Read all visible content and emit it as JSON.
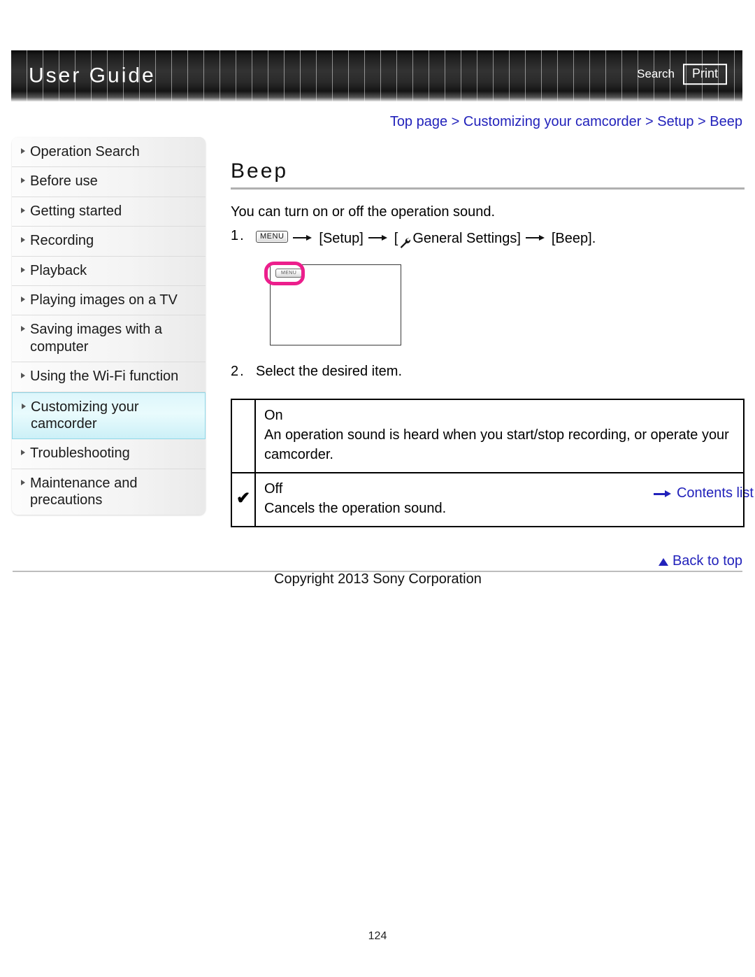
{
  "header": {
    "title": "User Guide",
    "search_label": "Search",
    "print_label": "Print"
  },
  "breadcrumb": {
    "text": "Top page > Customizing your camcorder > Setup > Beep"
  },
  "sidebar": {
    "items": [
      {
        "label": "Operation Search",
        "active": false
      },
      {
        "label": "Before use",
        "active": false
      },
      {
        "label": "Getting started",
        "active": false
      },
      {
        "label": "Recording",
        "active": false
      },
      {
        "label": "Playback",
        "active": false
      },
      {
        "label": "Playing images on a TV",
        "active": false
      },
      {
        "label": "Saving images with a computer",
        "active": false
      },
      {
        "label": "Using the Wi-Fi function",
        "active": false
      },
      {
        "label": "Customizing your camcorder",
        "active": true
      },
      {
        "label": "Troubleshooting",
        "active": false
      },
      {
        "label": "Maintenance and precautions",
        "active": false
      }
    ],
    "contents_list_label": "Contents list"
  },
  "main": {
    "title": "Beep",
    "intro": "You can turn on or off the operation sound.",
    "step1": {
      "number": "1.",
      "menu_chip": "MENU",
      "part_setup": "[Setup]",
      "part_general_open": "[",
      "part_general": "General Settings]",
      "part_beep": "[Beep]."
    },
    "illustration": {
      "menu_chip": "MENU"
    },
    "step2": {
      "number": "2.",
      "text": "Select the desired item."
    },
    "options": [
      {
        "mark": "",
        "label": "On",
        "description": "An operation sound is heard when you start/stop recording, or operate your camcorder."
      },
      {
        "mark": "✔",
        "label": "Off",
        "description": "Cancels the operation sound."
      }
    ]
  },
  "footer": {
    "back_to_top": "Back to top",
    "copyright": "Copyright 2013 Sony Corporation",
    "page_number": "124"
  },
  "colors": {
    "link_blue": "#2222bb",
    "highlight_magenta": "#ec1e8c",
    "active_nav_cyan": "#ddf6fb"
  }
}
